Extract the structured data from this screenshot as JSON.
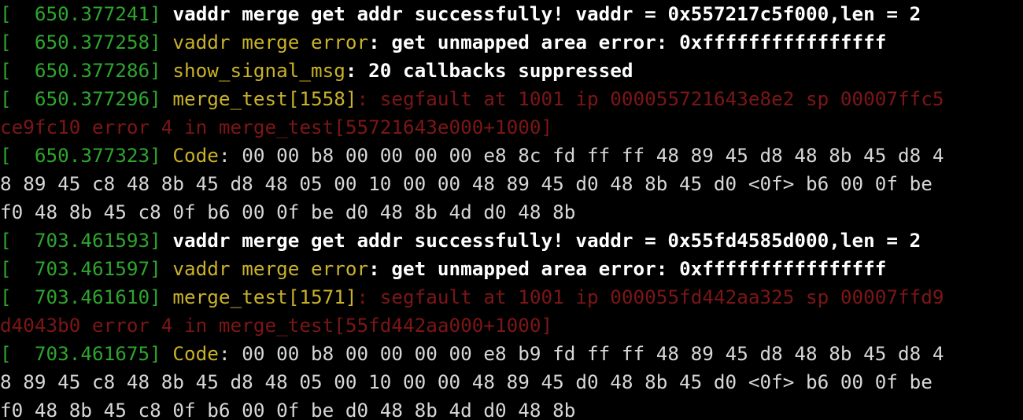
{
  "terminal": {
    "lines": [
      [
        {
          "t": "[  ",
          "c": "ts"
        },
        {
          "t": "650.377241] ",
          "c": "ts"
        },
        {
          "t": "vaddr merge get addr successfully! vaddr = 0x557217c5f000,len = 2",
          "c": "msg"
        }
      ],
      [
        {
          "t": "[  650.377258] ",
          "c": "ts"
        },
        {
          "t": "vaddr merge error",
          "c": "src"
        },
        {
          "t": ": get unmapped area error: 0xffffffffffffffff",
          "c": "msg"
        }
      ],
      [
        {
          "t": "[  650.377286] ",
          "c": "ts"
        },
        {
          "t": "show_signal_msg",
          "c": "src"
        },
        {
          "t": ": 20 callbacks suppressed",
          "c": "msg"
        }
      ],
      [
        {
          "t": "[  650.377296] ",
          "c": "ts"
        },
        {
          "t": "merge_test[1558]",
          "c": "src"
        },
        {
          "t": ": segfault at 1001 ip 000055721643e8e2 sp 00007ffc5",
          "c": "err"
        }
      ],
      [
        {
          "t": "ce9fc10 error 4 in merge_test[55721643e000+1000]",
          "c": "err"
        }
      ],
      [
        {
          "t": "[  650.377323] ",
          "c": "ts"
        },
        {
          "t": "Code",
          "c": "src"
        },
        {
          "t": ": 00 00 b8 00 00 00 00 e8 8c fd ff ff 48 89 45 d8 48 8b 45 d8 4",
          "c": "plain"
        }
      ],
      [
        {
          "t": "8 89 45 c8 48 8b 45 d8 48 05 00 10 00 00 48 89 45 d0 48 8b 45 d0 <0f> b6 00 0f be",
          "c": "plain"
        }
      ],
      [
        {
          "t": "f0 48 8b 45 c8 0f b6 00 0f be d0 48 8b 4d d0 48 8b",
          "c": "plain"
        }
      ],
      [
        {
          "t": "[  703.461593] ",
          "c": "ts"
        },
        {
          "t": "vaddr merge get addr successfully! vaddr = 0x55fd4585d000,len = 2",
          "c": "msg"
        }
      ],
      [
        {
          "t": "[  703.461597] ",
          "c": "ts"
        },
        {
          "t": "vaddr merge error",
          "c": "src"
        },
        {
          "t": ": get unmapped area error: 0xffffffffffffffff",
          "c": "msg"
        }
      ],
      [
        {
          "t": "[  703.461610] ",
          "c": "ts"
        },
        {
          "t": "merge_test[1571]",
          "c": "src"
        },
        {
          "t": ": segfault at 1001 ip 000055fd442aa325 sp 00007ffd9",
          "c": "err"
        }
      ],
      [
        {
          "t": "d4043b0 error 4 in merge_test[55fd442aa000+1000]",
          "c": "err"
        }
      ],
      [
        {
          "t": "[  703.461675] ",
          "c": "ts"
        },
        {
          "t": "Code",
          "c": "src"
        },
        {
          "t": ": 00 00 b8 00 00 00 00 e8 b9 fd ff ff 48 89 45 d8 48 8b 45 d8 4",
          "c": "plain"
        }
      ],
      [
        {
          "t": "8 89 45 c8 48 8b 45 d8 48 05 00 10 00 00 48 89 45 d0 48 8b 45 d0 <0f> b6 00 0f be",
          "c": "plain"
        }
      ],
      [
        {
          "t": "f0 48 8b 45 c8 0f b6 00 0f be d0 48 8b 4d d0 48 8b",
          "c": "plain"
        }
      ]
    ]
  },
  "colors": {
    "background": "#000000",
    "timestamp": "#2ea52e",
    "source": "#c9b22a",
    "message": "#ffffff",
    "plain": "#d7d7d7",
    "error": "#7c1616"
  }
}
